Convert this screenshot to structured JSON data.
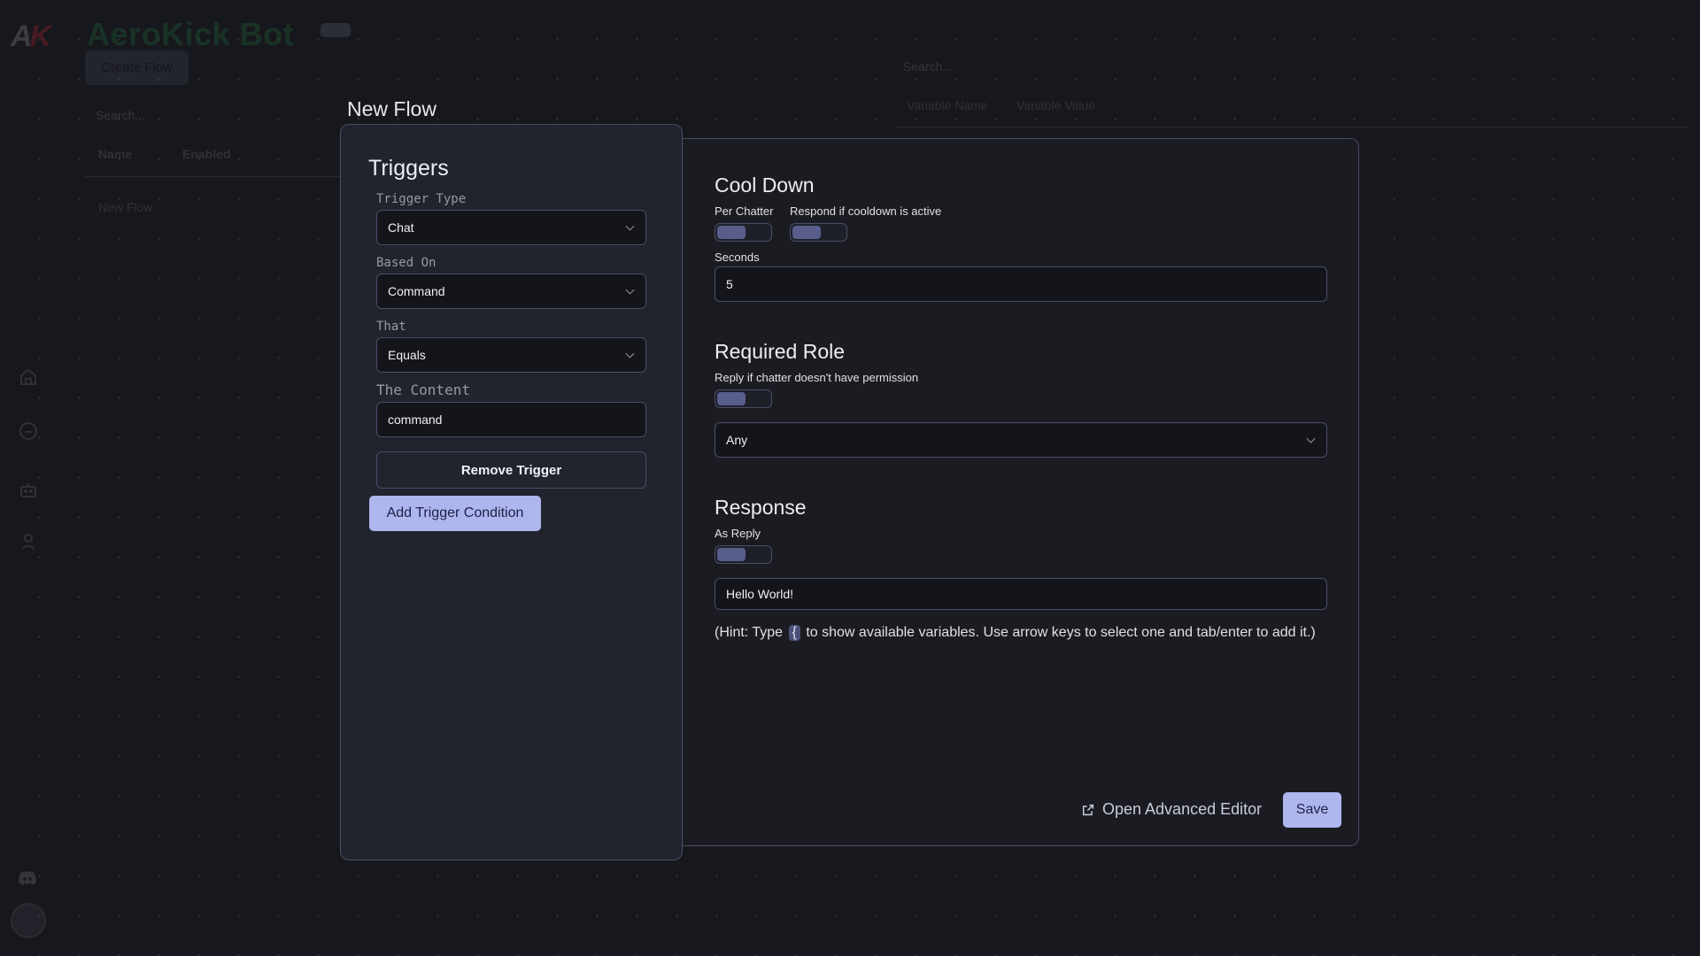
{
  "background_app": {
    "logo_letters": [
      "A",
      "K"
    ],
    "app_title": "AeroKick Bot",
    "create_flow_label": "Create Flow",
    "flows_search_placeholder": "Search...",
    "flows_columns": [
      "Name",
      "Enabled"
    ],
    "flows_rows": [
      {
        "name": "New Flow"
      }
    ],
    "variables_search_placeholder": "Search...",
    "variables_columns": [
      "Variable Name",
      "Variable Value"
    ],
    "sidebar_icons": [
      "home-icon",
      "chat-icon",
      "bot-icon",
      "user-icon"
    ],
    "sidebar_bottom_icons": [
      "discord-icon",
      "avatar"
    ]
  },
  "modal": {
    "title": "New Flow",
    "triggers": {
      "heading": "Triggers",
      "trigger_type": {
        "label": "Trigger Type",
        "value": "Chat"
      },
      "based_on": {
        "label": "Based On",
        "value": "Command"
      },
      "that": {
        "label": "That",
        "value": "Equals"
      },
      "content": {
        "label": "The Content",
        "value": "command"
      },
      "remove_label": "Remove Trigger",
      "add_condition_label": "Add Trigger Condition"
    },
    "cooldown": {
      "heading": "Cool Down",
      "per_chatter_label": "Per Chatter",
      "per_chatter_on": false,
      "respond_active_label": "Respond if cooldown is active",
      "respond_active_on": false,
      "seconds_label": "Seconds",
      "seconds_value": "5"
    },
    "required_role": {
      "heading": "Required Role",
      "reply_no_permission_label": "Reply if chatter doesn't have permission",
      "reply_no_permission_on": false,
      "role_value": "Any"
    },
    "response": {
      "heading": "Response",
      "as_reply_label": "As Reply",
      "as_reply_on": false,
      "message_value": "Hello World!",
      "hint_before": "(Hint: Type",
      "hint_key": "{",
      "hint_after": "to show available variables. Use arrow keys to select one and tab/enter to add it.)"
    },
    "footer": {
      "advanced_editor_label": "Open Advanced Editor",
      "save_label": "Save"
    }
  },
  "colors": {
    "accent": "#aeb6ee",
    "toggle_knob": "#585d8c",
    "border": "#4b4c68",
    "background": "#17181d"
  }
}
